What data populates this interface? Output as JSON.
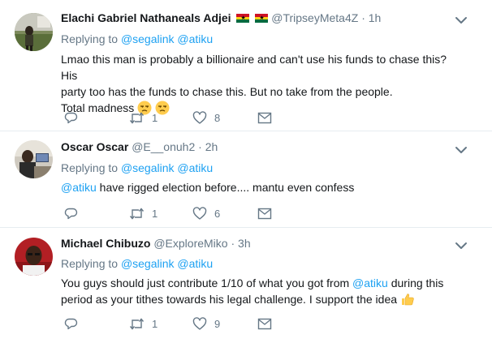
{
  "tweets": [
    {
      "name": "Elachi Gabriel Nathaneals Adjei",
      "handle": "@TripseyMeta4Z",
      "sep": "·",
      "time": "1h",
      "replying_prefix": "Replying to ",
      "replying_to": [
        "@segalink",
        "@atiku"
      ],
      "lines": [
        "Lmao this man is probably a billionaire and can't use his funds to chase this? His",
        "party too has the funds to chase this. But no take from the people.",
        "Total madness"
      ],
      "emojis": [
        "unamused-face-icon",
        "unamused-face-icon"
      ],
      "flags": [
        "ghana-flag-icon",
        "ghana-flag-icon"
      ],
      "retweets": "1",
      "likes": "8"
    },
    {
      "name": "Oscar Oscar",
      "handle": "@E__onuh2",
      "sep": "·",
      "time": "2h",
      "replying_prefix": "Replying to ",
      "replying_to": [
        "@segalink",
        "@atiku"
      ],
      "mention": "@atiku",
      "text": " have rigged election before.... mantu even confess",
      "retweets": "1",
      "likes": "6"
    },
    {
      "name": "Michael Chibuzo",
      "handle": "@ExploreMiko",
      "sep": "·",
      "time": "3h",
      "replying_prefix": "Replying to ",
      "replying_to": [
        "@segalink",
        "@atiku"
      ],
      "line1_pre": "You guys should just contribute 1/10 of what you got from ",
      "line1_mention": "@atiku",
      "line1_post": " during this",
      "line2": "period as your tithes towards his legal challenge. I support the idea",
      "emojis": [
        "thumbs-up-icon"
      ],
      "retweets": "1",
      "likes": "9"
    }
  ],
  "colors": {
    "link": "#1da1f2",
    "secondary_text": "#657786",
    "primary_text": "#14171a",
    "divider": "#e6ecf0"
  }
}
